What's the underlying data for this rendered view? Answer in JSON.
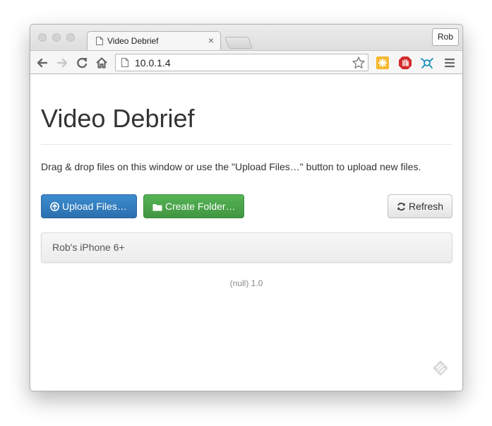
{
  "browser": {
    "tab_title": "Video Debrief",
    "tab_close": "×",
    "profile_name": "Rob",
    "url": "10.0.1.4"
  },
  "page": {
    "title": "Video Debrief",
    "intro": "Drag & drop files on this window or use the \"Upload Files…\" button to upload new files.",
    "buttons": {
      "upload": "Upload Files…",
      "create_folder": "Create Folder…",
      "refresh": "Refresh"
    },
    "list": [
      {
        "label": "Rob's iPhone 6+"
      }
    ],
    "footer": "(null) 1.0"
  },
  "colors": {
    "primary": "#337ab7",
    "success": "#4aa24a",
    "text": "#333333"
  },
  "icons": {
    "upload": "circle-arrow-up-icon",
    "folder": "folder-icon",
    "refresh": "refresh-icon"
  }
}
